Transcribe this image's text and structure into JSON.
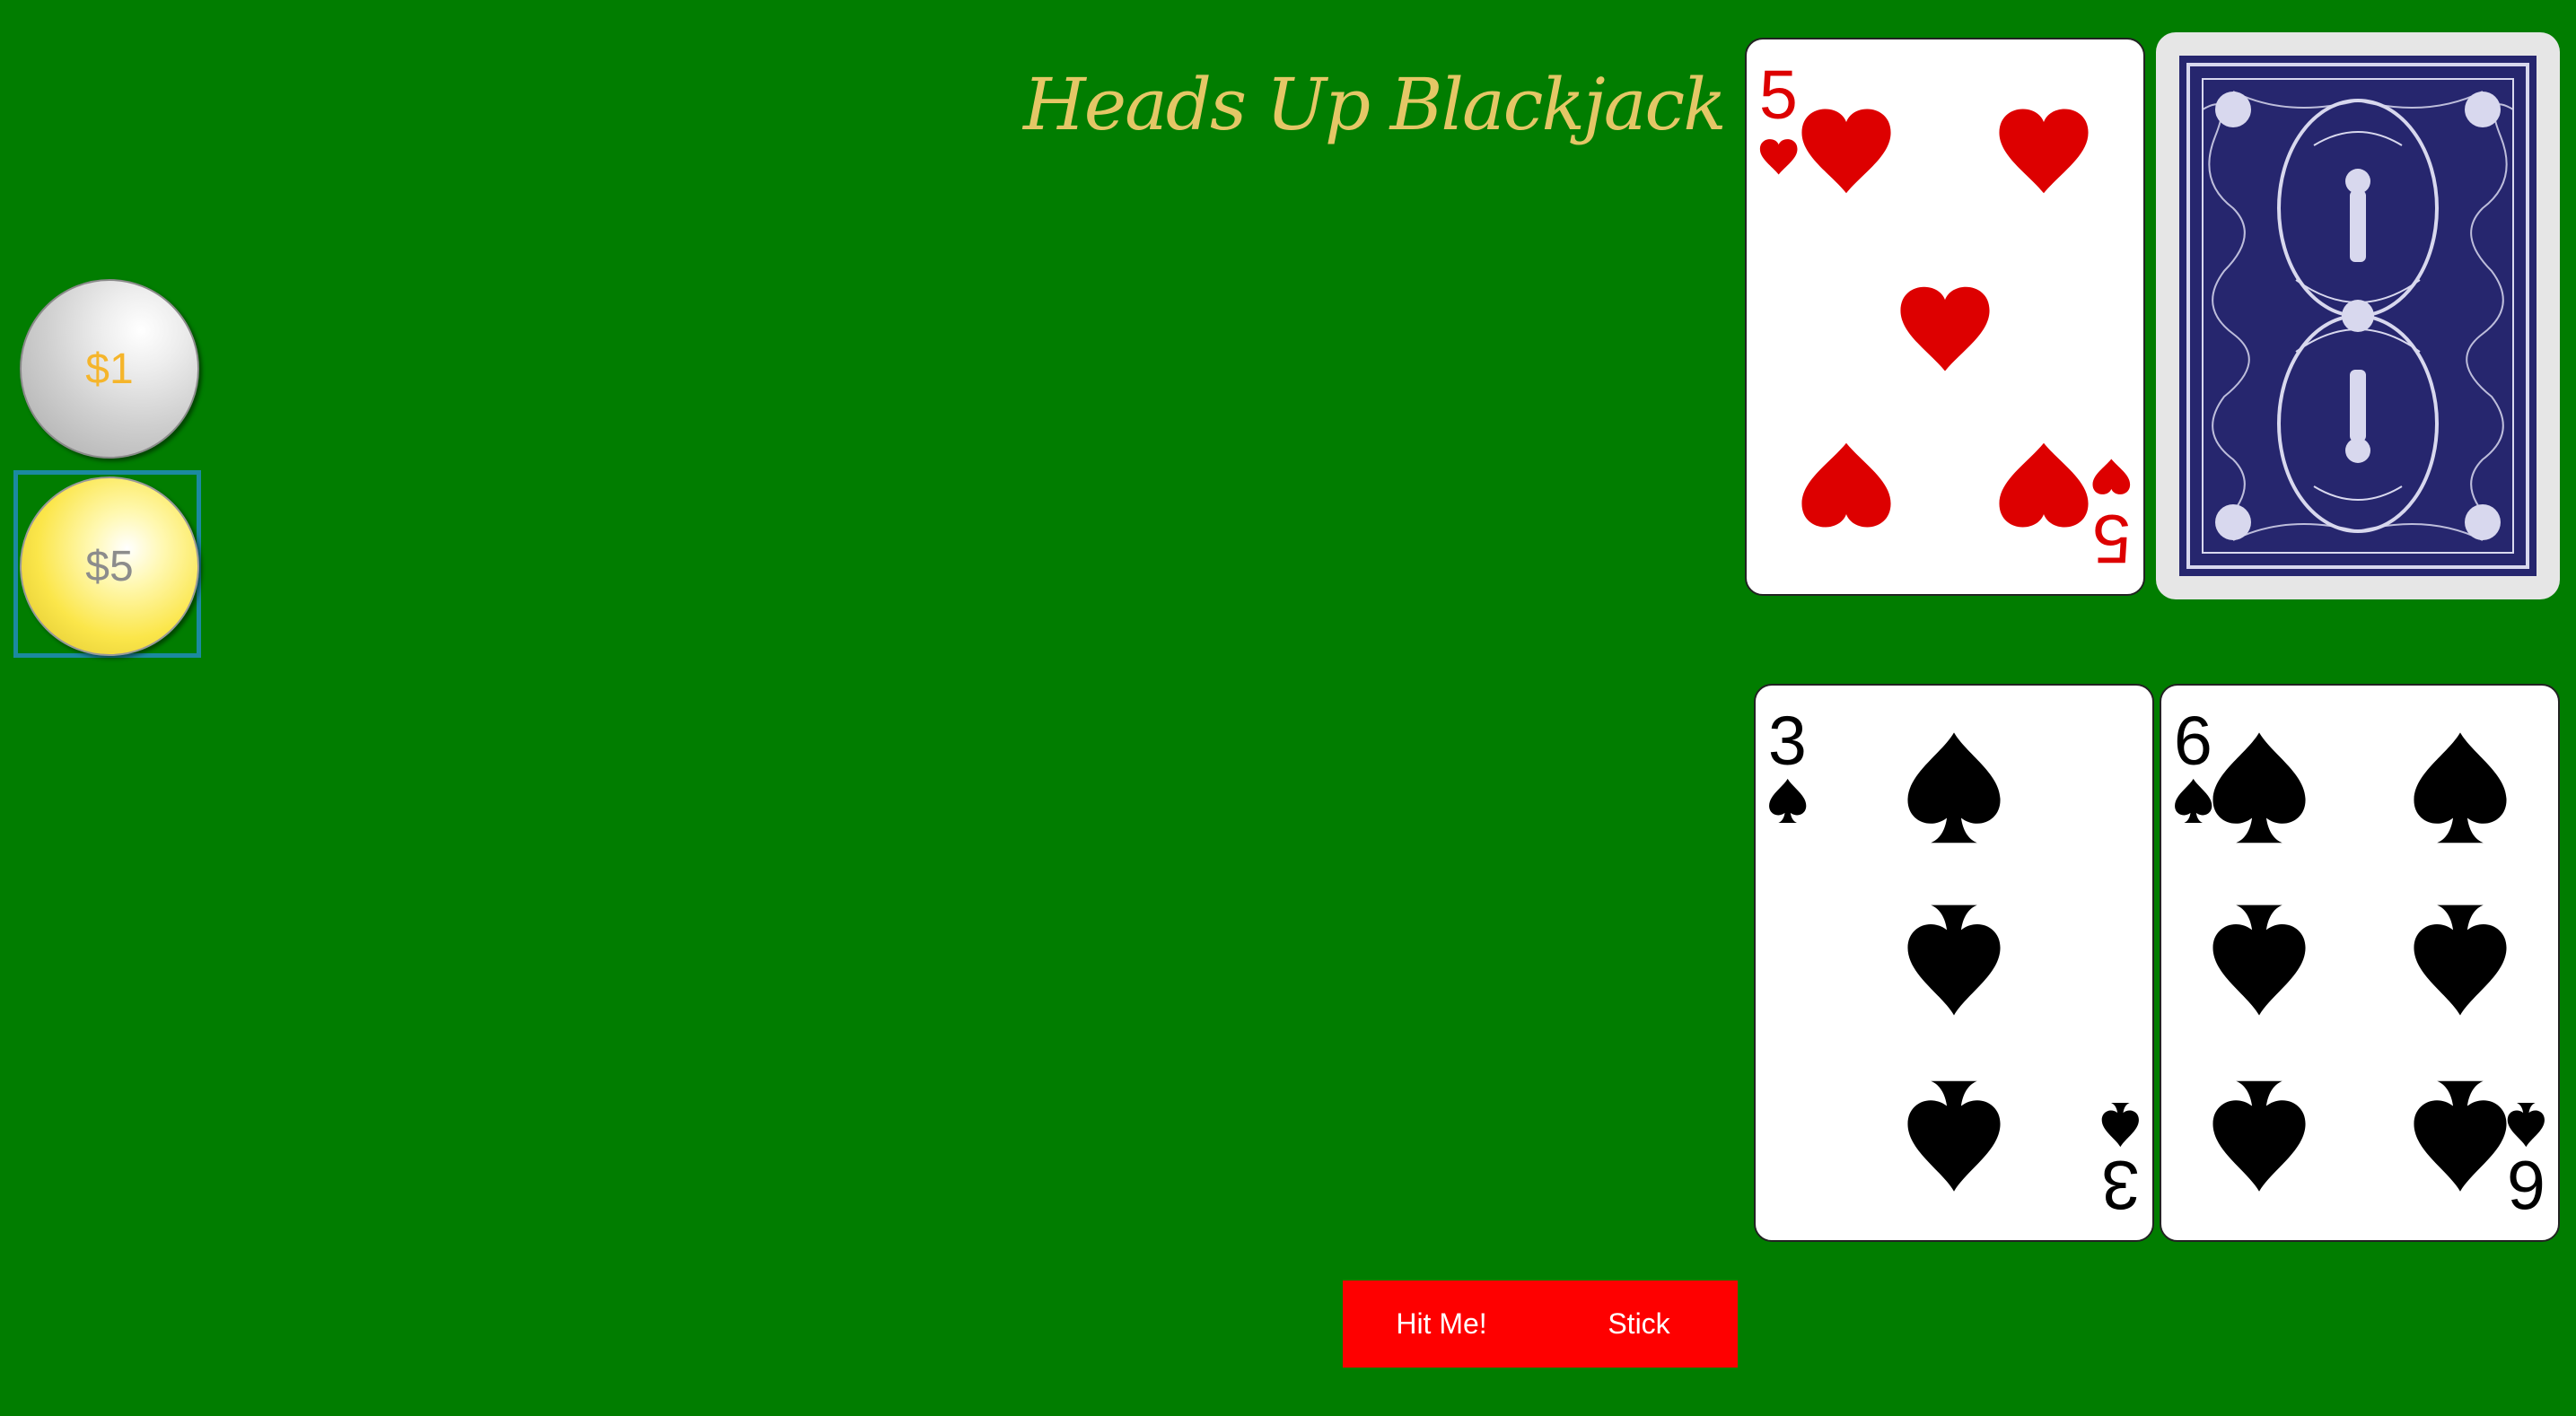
{
  "header": {
    "title": "Heads Up Blackjack"
  },
  "chips": [
    {
      "label": "$1",
      "color": "#f5b52b"
    },
    {
      "label": "$5",
      "color": "#8c8c8c"
    }
  ],
  "dealer": {
    "cards": [
      {
        "rank": "5",
        "suit": "hearts"
      },
      {
        "face": "down"
      }
    ]
  },
  "player": {
    "cards": [
      {
        "rank": "3",
        "suit": "spades"
      },
      {
        "rank": "6",
        "suit": "spades"
      }
    ]
  },
  "controls": {
    "hit_label": "Hit Me!",
    "stick_label": "Stick"
  },
  "colors": {
    "table": "#017d00",
    "title": "#e4c766",
    "buttons": "#fe0000",
    "red_suit": "#dd0000",
    "black_suit": "#000000",
    "card_back": "#26266e"
  },
  "icons": [
    "heart-icon",
    "spade-icon"
  ]
}
